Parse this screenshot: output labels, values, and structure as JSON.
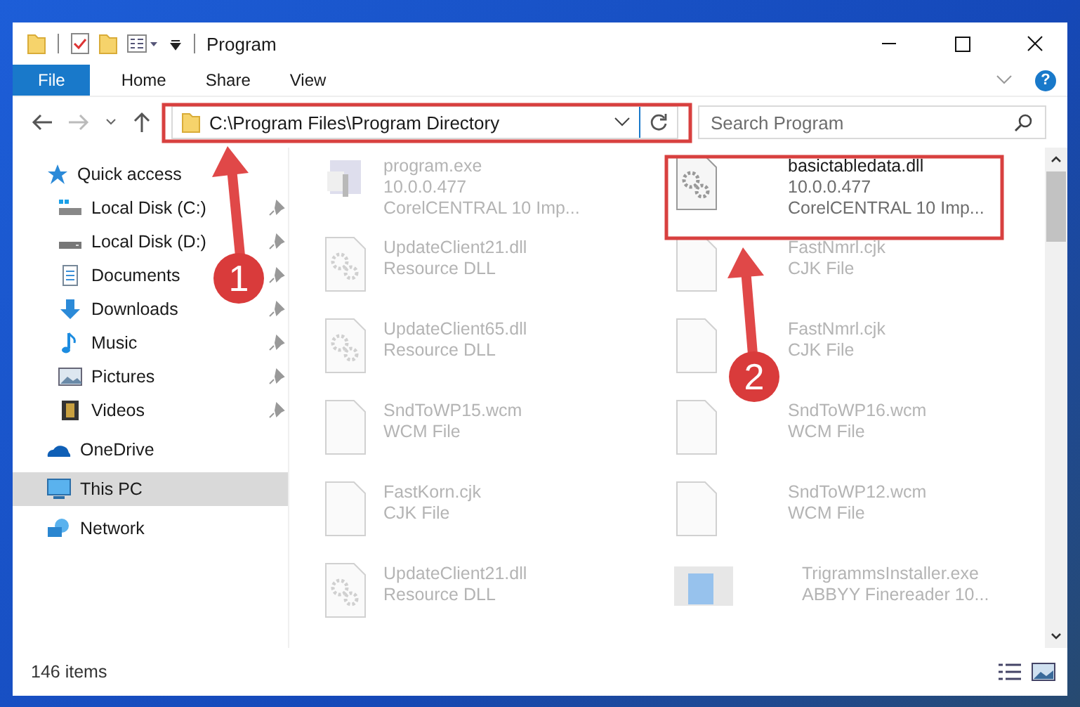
{
  "window": {
    "title": "Program"
  },
  "ribbon": {
    "tabs": [
      {
        "label": "File",
        "kind": "file"
      },
      {
        "label": "Home",
        "kind": "tab"
      },
      {
        "label": "Share",
        "kind": "tab"
      },
      {
        "label": "View",
        "kind": "tab"
      }
    ],
    "help": "?"
  },
  "address_bar": {
    "path": "C:\\Program Files\\Program Directory"
  },
  "search": {
    "placeholder": "Search Program"
  },
  "sidebar": {
    "items": [
      {
        "label": "Quick access",
        "kind": "star",
        "selected": false,
        "children": [
          {
            "label": "Local Disk (C:)",
            "kind": "drive-c",
            "pinned": true,
            "selected": false
          },
          {
            "label": "Local Disk (D:)",
            "kind": "drive",
            "pinned": true,
            "selected": false
          },
          {
            "label": "Documents",
            "kind": "documents",
            "pinned": true,
            "selected": false
          },
          {
            "label": "Downloads",
            "kind": "downloads",
            "pinned": true,
            "selected": false
          },
          {
            "label": "Music",
            "kind": "music",
            "pinned": true,
            "selected": false
          },
          {
            "label": "Pictures",
            "kind": "pictures",
            "pinned": true,
            "selected": false
          },
          {
            "label": "Videos",
            "kind": "videos",
            "pinned": true,
            "selected": false
          }
        ]
      },
      {
        "label": "OneDrive",
        "kind": "cloud",
        "selected": false
      },
      {
        "label": "This PC",
        "kind": "pc",
        "selected": true
      },
      {
        "label": "Network",
        "kind": "network",
        "selected": false
      }
    ]
  },
  "files": [
    {
      "name": "program.exe",
      "lines": [
        "10.0.0.477",
        "CorelCENTRAL 10 Imp..."
      ],
      "kind": "exe",
      "dimmed": true
    },
    {
      "name": "basictabledata.dll",
      "lines": [
        "10.0.0.477",
        "CorelCENTRAL 10 Imp..."
      ],
      "kind": "gear",
      "dimmed": false
    },
    {
      "name": "UpdateClient21.dll",
      "lines": [
        "Resource DLL"
      ],
      "kind": "gear",
      "dimmed": true
    },
    {
      "name": "FastNmrl.cjk",
      "lines": [
        "CJK File"
      ],
      "kind": "blank",
      "dimmed": true
    },
    {
      "name": "UpdateClient65.dll",
      "lines": [
        "Resource DLL"
      ],
      "kind": "gear",
      "dimmed": true
    },
    {
      "name": "FastNmrl.cjk",
      "lines": [
        "CJK File"
      ],
      "kind": "blank",
      "dimmed": true
    },
    {
      "name": "SndToWP15.wcm",
      "lines": [
        "WCM File"
      ],
      "kind": "blank",
      "dimmed": true
    },
    {
      "name": "SndToWP16.wcm",
      "lines": [
        "WCM File"
      ],
      "kind": "blank",
      "dimmed": true
    },
    {
      "name": "FastKorn.cjk",
      "lines": [
        "CJK File"
      ],
      "kind": "blank",
      "dimmed": true
    },
    {
      "name": "SndToWP12.wcm",
      "lines": [
        "WCM File"
      ],
      "kind": "blank",
      "dimmed": true
    },
    {
      "name": "UpdateClient21.dll",
      "lines": [
        "Resource DLL"
      ],
      "kind": "gear",
      "dimmed": true
    },
    {
      "name": "TrigrammsInstaller.exe",
      "lines": [
        "ABBYY Finereader 10..."
      ],
      "kind": "installer",
      "dimmed": true
    }
  ],
  "status_bar": {
    "count": "146 items"
  },
  "annotations": [
    {
      "number": "1"
    },
    {
      "number": "2"
    }
  ]
}
